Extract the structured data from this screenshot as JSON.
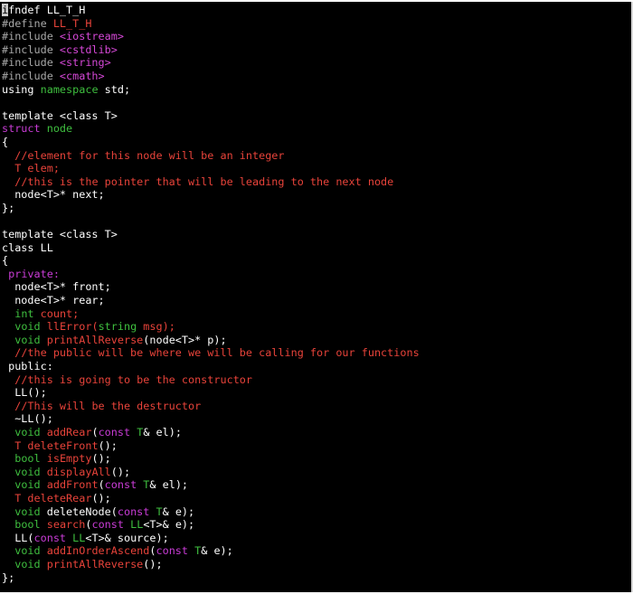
{
  "colors": {
    "background": "#000000",
    "default": "#ffffff",
    "preproc": "#a8a8a8",
    "string": "#d648d7",
    "keyword": "#c93cd6",
    "type": "#3fbf3f",
    "comment": "#e8433a",
    "cursor": "#c8c8c8"
  },
  "editor": {
    "lines": [
      [
        [
          "cursor",
          "i"
        ],
        [
          "default",
          "fndef LL_T_H"
        ]
      ],
      [
        [
          "preproc",
          "#define "
        ],
        [
          "comment",
          "LL_T_H"
        ]
      ],
      [
        [
          "preproc",
          "#include "
        ],
        [
          "string",
          "<iostream>"
        ]
      ],
      [
        [
          "preproc",
          "#include "
        ],
        [
          "string",
          "<cstdlib>"
        ]
      ],
      [
        [
          "preproc",
          "#include "
        ],
        [
          "string",
          "<string>"
        ]
      ],
      [
        [
          "preproc",
          "#include "
        ],
        [
          "string",
          "<cmath>"
        ]
      ],
      [
        [
          "default",
          "using "
        ],
        [
          "type",
          "namespace"
        ],
        [
          "default",
          " std;"
        ]
      ],
      [],
      [
        [
          "default",
          "template <class T>"
        ]
      ],
      [
        [
          "keyword",
          "struct "
        ],
        [
          "type",
          "node"
        ]
      ],
      [
        [
          "default",
          "{"
        ]
      ],
      [
        [
          "default",
          "  "
        ],
        [
          "comment",
          "//element for this node will be an integer"
        ]
      ],
      [
        [
          "default",
          "  "
        ],
        [
          "comment",
          "T elem;"
        ]
      ],
      [
        [
          "default",
          "  "
        ],
        [
          "comment",
          "//this is the pointer that will be leading to the next node"
        ]
      ],
      [
        [
          "default",
          "  node<T>* next;"
        ]
      ],
      [
        [
          "default",
          "};"
        ]
      ],
      [],
      [
        [
          "default",
          "template <class T>"
        ]
      ],
      [
        [
          "default",
          "class LL"
        ]
      ],
      [
        [
          "default",
          "{"
        ]
      ],
      [
        [
          "default",
          " "
        ],
        [
          "keyword",
          "private:"
        ]
      ],
      [
        [
          "default",
          "  node<T>* front;"
        ]
      ],
      [
        [
          "default",
          "  node<T>* rear;"
        ]
      ],
      [
        [
          "default",
          "  "
        ],
        [
          "type",
          "int"
        ],
        [
          "comment",
          " count;"
        ]
      ],
      [
        [
          "default",
          "  "
        ],
        [
          "type",
          "void"
        ],
        [
          "comment",
          " llError("
        ],
        [
          "type",
          "string"
        ],
        [
          "comment",
          " msg);"
        ]
      ],
      [
        [
          "default",
          "  "
        ],
        [
          "type",
          "void"
        ],
        [
          "comment",
          " printAllReverse"
        ],
        [
          "default",
          "(node<T>* p);"
        ]
      ],
      [
        [
          "default",
          "  "
        ],
        [
          "comment",
          "//the public will be where we will be calling for our functions"
        ]
      ],
      [
        [
          "default",
          " public:"
        ]
      ],
      [
        [
          "default",
          "  "
        ],
        [
          "comment",
          "//this is going to be the constructor"
        ]
      ],
      [
        [
          "default",
          "  LL();"
        ]
      ],
      [
        [
          "default",
          "  "
        ],
        [
          "comment",
          "//This will be the destructor"
        ]
      ],
      [
        [
          "default",
          "  ~LL();"
        ]
      ],
      [
        [
          "default",
          "  "
        ],
        [
          "type",
          "void"
        ],
        [
          "comment",
          " addRear"
        ],
        [
          "default",
          "("
        ],
        [
          "keyword",
          "const"
        ],
        [
          "default",
          " "
        ],
        [
          "type",
          "T"
        ],
        [
          "default",
          "& el);"
        ]
      ],
      [
        [
          "default",
          "  "
        ],
        [
          "comment",
          "T deleteFront"
        ],
        [
          "default",
          "();"
        ]
      ],
      [
        [
          "default",
          "  "
        ],
        [
          "type",
          "bool"
        ],
        [
          "comment",
          " isEmpty"
        ],
        [
          "default",
          "();"
        ]
      ],
      [
        [
          "default",
          "  "
        ],
        [
          "type",
          "void"
        ],
        [
          "comment",
          " displayAll"
        ],
        [
          "default",
          "();"
        ]
      ],
      [
        [
          "default",
          "  "
        ],
        [
          "type",
          "void"
        ],
        [
          "comment",
          " addFront"
        ],
        [
          "default",
          "("
        ],
        [
          "keyword",
          "const"
        ],
        [
          "default",
          " "
        ],
        [
          "type",
          "T"
        ],
        [
          "default",
          "& el);"
        ]
      ],
      [
        [
          "default",
          "  "
        ],
        [
          "comment",
          "T deleteRear"
        ],
        [
          "default",
          "();"
        ]
      ],
      [
        [
          "default",
          "  "
        ],
        [
          "type",
          "void"
        ],
        [
          "default",
          " deleteNode("
        ],
        [
          "keyword",
          "const"
        ],
        [
          "default",
          " "
        ],
        [
          "type",
          "T"
        ],
        [
          "default",
          "& e);"
        ]
      ],
      [
        [
          "default",
          "  "
        ],
        [
          "type",
          "bool"
        ],
        [
          "comment",
          " search"
        ],
        [
          "default",
          "("
        ],
        [
          "keyword",
          "const"
        ],
        [
          "default",
          " "
        ],
        [
          "type",
          "LL"
        ],
        [
          "default",
          "<T>& e);"
        ]
      ],
      [
        [
          "default",
          "  LL("
        ],
        [
          "keyword",
          "const"
        ],
        [
          "default",
          " "
        ],
        [
          "type",
          "LL"
        ],
        [
          "default",
          "<T>& source);"
        ]
      ],
      [
        [
          "default",
          "  "
        ],
        [
          "type",
          "void"
        ],
        [
          "comment",
          " addInOrderAscend"
        ],
        [
          "default",
          "("
        ],
        [
          "keyword",
          "const"
        ],
        [
          "default",
          " "
        ],
        [
          "type",
          "T"
        ],
        [
          "default",
          "& e);"
        ]
      ],
      [
        [
          "default",
          "  "
        ],
        [
          "type",
          "void"
        ],
        [
          "comment",
          " printAllReverse"
        ],
        [
          "default",
          "();"
        ]
      ],
      [
        [
          "default",
          "};"
        ]
      ]
    ]
  }
}
